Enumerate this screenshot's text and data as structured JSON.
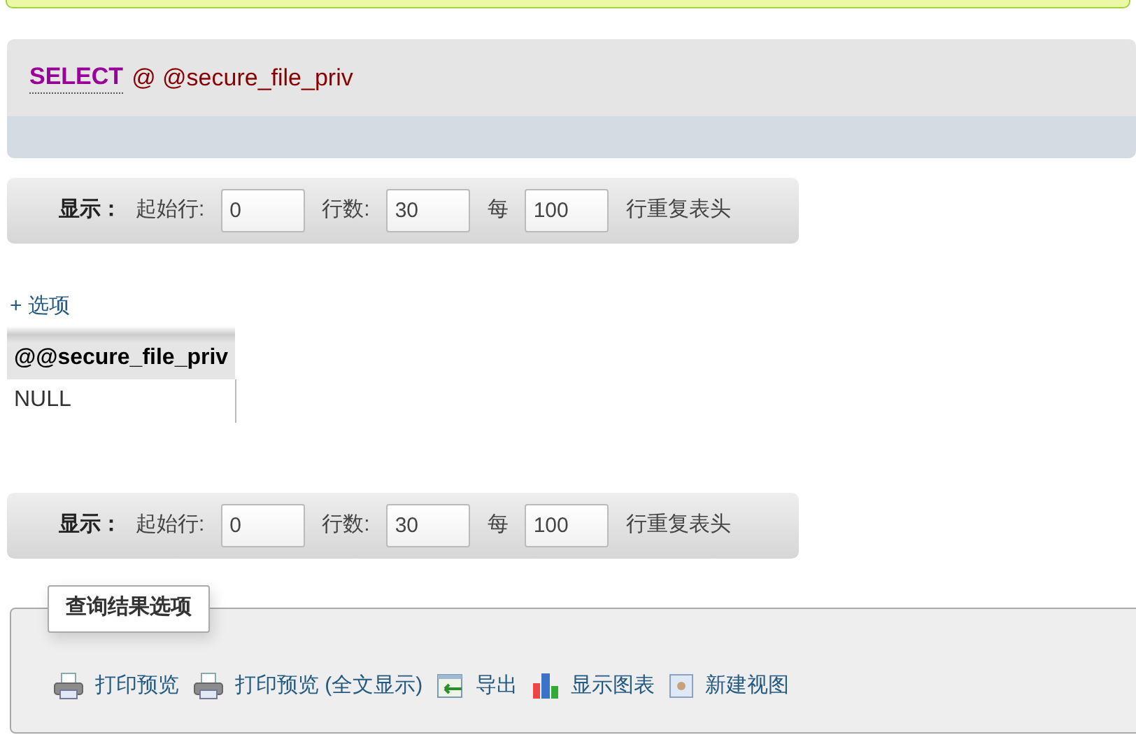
{
  "sql_query": {
    "keyword": "SELECT",
    "text": "@ @secure_file_priv"
  },
  "navigation_bars": [
    {
      "label": "显示：",
      "start_label": "起始行:",
      "start_value": "0",
      "rows_label": "行数:",
      "rows_value": "30",
      "every_label": "每",
      "every_value": "100",
      "suffix": "行重复表头"
    },
    {
      "label": "显示：",
      "start_label": "起始行:",
      "start_value": "0",
      "rows_label": "行数:",
      "rows_value": "30",
      "every_label": "每",
      "every_value": "100",
      "suffix": "行重复表头"
    }
  ],
  "options_link": "+ 选项",
  "table": {
    "columns": [
      "@@secure_file_priv"
    ],
    "rows": [
      [
        "NULL"
      ]
    ]
  },
  "query_results_operations": {
    "legend": "查询结果选项",
    "actions": [
      {
        "kind": "print",
        "label": "打印预览"
      },
      {
        "kind": "print",
        "label": "打印预览 (全文显示)"
      },
      {
        "kind": "export",
        "label": "导出"
      },
      {
        "kind": "chart",
        "label": "显示图表"
      },
      {
        "kind": "view",
        "label": "新建视图"
      }
    ]
  }
}
